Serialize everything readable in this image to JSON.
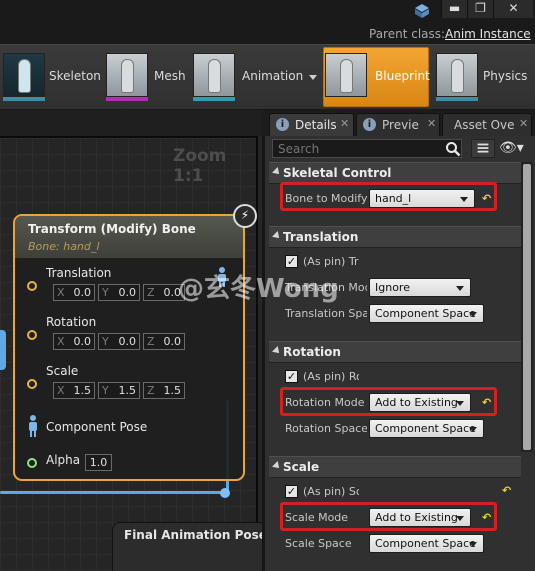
{
  "window": {
    "parent_class_label": "Parent class:",
    "parent_class_value": "Anim Instance",
    "min_glyph": "▬",
    "max_glyph": "❐",
    "close_glyph": "✕"
  },
  "modes": [
    {
      "label": "Skeleton",
      "bar_color": "#3a8fa8"
    },
    {
      "label": "Mesh",
      "bar_color": "#b82ab8"
    },
    {
      "label": "Animation",
      "bar_color": "#2a9fb8"
    },
    {
      "label": "Blueprint",
      "bar_color": "#3a8fa8"
    },
    {
      "label": "Physics",
      "bar_color": "#3a8fa8"
    }
  ],
  "graph": {
    "zoom_label": "Zoom 1:1",
    "node": {
      "title": "Transform (Modify) Bone",
      "subtitle": "Bone: hand_l",
      "bolt_glyph": "⚡",
      "translation": {
        "label": "Translation",
        "x": "0.0",
        "y": "0.0",
        "z": "0.0"
      },
      "rotation": {
        "label": "Rotation",
        "x": "0.0",
        "y": "0.0",
        "z": "0.0"
      },
      "scale": {
        "label": "Scale",
        "x": "1.5",
        "y": "1.5",
        "z": "1.5"
      },
      "component_pose_label": "Component Pose",
      "alpha_label": "Alpha",
      "alpha_value": "1.0"
    },
    "axis_x": "X",
    "axis_y": "Y",
    "axis_z": "Z",
    "final_node_title": "Final Animation Pose"
  },
  "tabs": [
    {
      "label": "Details",
      "icon": "i",
      "close": "✕"
    },
    {
      "label": "Previe",
      "icon": "i",
      "close": "✕"
    },
    {
      "label": "Asset Ove",
      "icon": "",
      "close": "✕"
    }
  ],
  "details": {
    "search_placeholder": "Search",
    "eye_glyph": "👁▾",
    "reset_glyph": "↶",
    "sections": {
      "skeletal_control": {
        "title": "Skeletal Control",
        "bone_label": "Bone to Modify",
        "bone_value": "hand_l"
      },
      "translation": {
        "title": "Translation",
        "as_pin_label": "(As pin) Tra",
        "mode_label": "Translation Mod",
        "mode_value": "Ignore",
        "space_label": "Translation Spa",
        "space_value": "Component Space"
      },
      "rotation": {
        "title": "Rotation",
        "as_pin_label": "(As pin) Rot",
        "mode_label": "Rotation Mode",
        "mode_value": "Add to Existing",
        "space_label": "Rotation Space",
        "space_value": "Component Space"
      },
      "scale": {
        "title": "Scale",
        "as_pin_label": "(As pin) Sca",
        "mode_label": "Scale Mode",
        "mode_value": "Add to Existing",
        "space_label": "Scale Space",
        "space_value": "Component Space"
      }
    }
  },
  "watermark": "@玄冬Wong"
}
